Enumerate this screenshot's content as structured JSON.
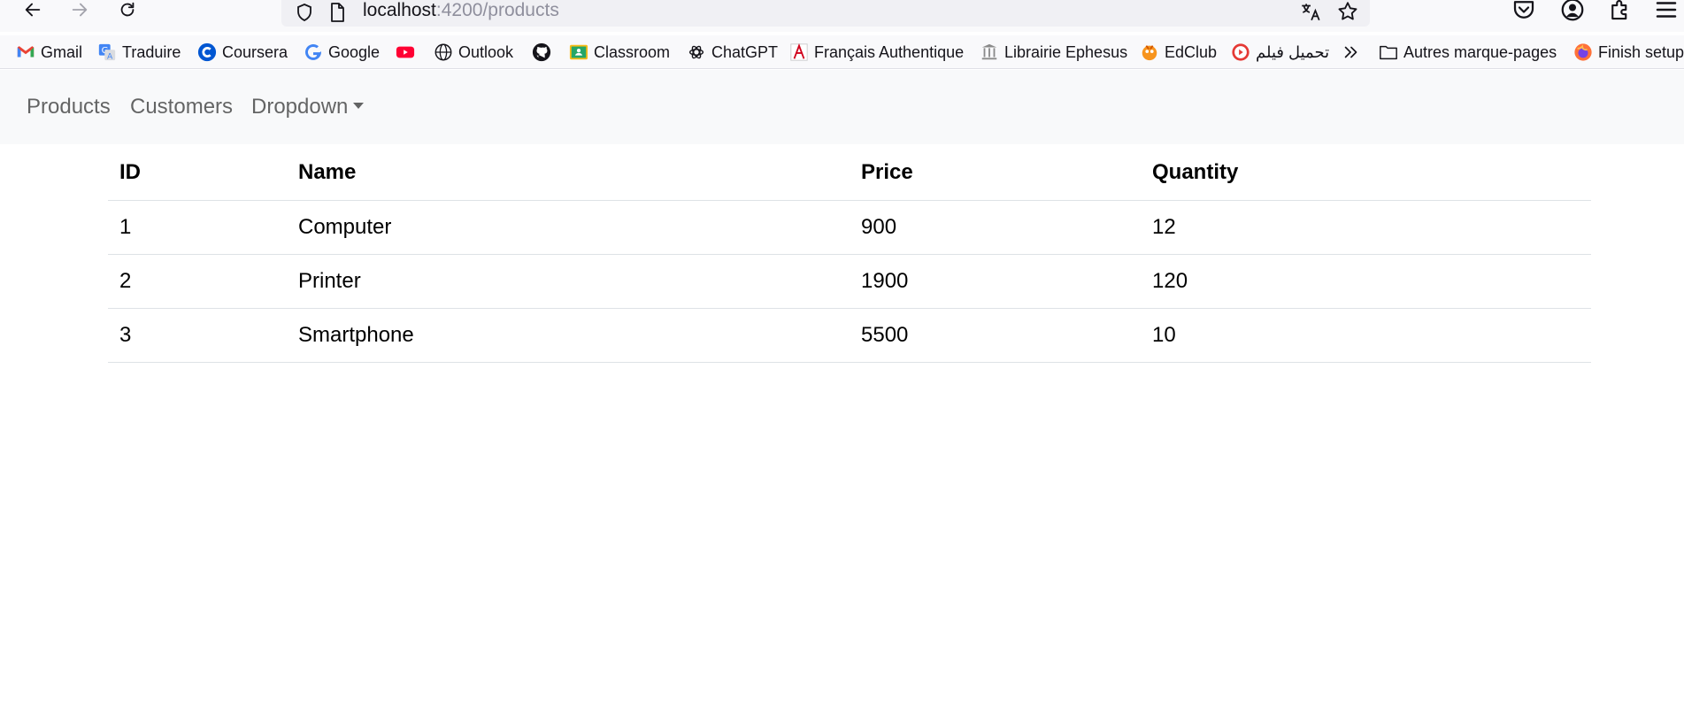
{
  "browser": {
    "url_host": "localhost",
    "url_path": ":4200/products"
  },
  "bookmarks": [
    {
      "label": "Gmail",
      "icon": "gmail-icon"
    },
    {
      "label": "Traduire",
      "icon": "translate-icon"
    },
    {
      "label": "Coursera",
      "icon": "coursera-icon"
    },
    {
      "label": "Google",
      "icon": "google-icon"
    },
    {
      "label": "",
      "icon": "youtube-icon"
    },
    {
      "label": "Outlook",
      "icon": "globe-icon"
    },
    {
      "label": "",
      "icon": "github-icon"
    },
    {
      "label": "Classroom",
      "icon": "classroom-icon"
    },
    {
      "label": "ChatGPT",
      "icon": "chatgpt-icon"
    },
    {
      "label": "Français Authentique",
      "icon": "francais-authentique-icon"
    },
    {
      "label": "Librairie Ephesus",
      "icon": "ephesus-icon"
    },
    {
      "label": "EdClub",
      "icon": "edclub-icon"
    },
    {
      "label": "تحميل فيلم",
      "icon": "play-icon"
    },
    {
      "label": "Autres marque-pages",
      "icon": "folder-icon"
    },
    {
      "label": "Finish setup",
      "icon": "firefox-icon"
    }
  ],
  "colors": {
    "navbar_bg": "#f8f9fa",
    "youtube": "#ff0033",
    "coursera": "#0056d2"
  },
  "navbar": {
    "products": "Products",
    "customers": "Customers",
    "dropdown": "Dropdown"
  },
  "table": {
    "headers": [
      "ID",
      "Name",
      "Price",
      "Quantity"
    ],
    "rows": [
      [
        "1",
        "Computer",
        "900",
        "12"
      ],
      [
        "2",
        "Printer",
        "1900",
        "120"
      ],
      [
        "3",
        "Smartphone",
        "5500",
        "10"
      ]
    ]
  }
}
